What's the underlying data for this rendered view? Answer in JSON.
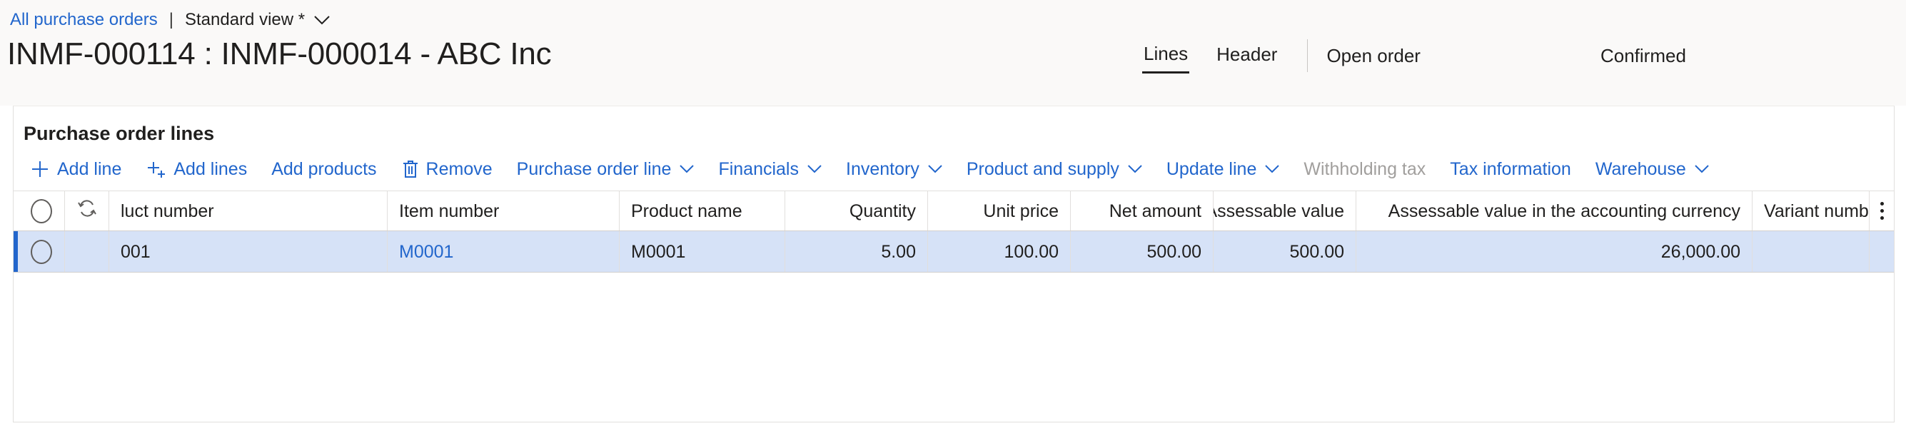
{
  "breadcrumb": {
    "back_link": "All purchase orders",
    "separator": "|",
    "view_name": "Standard view *",
    "chevron_icon": "chevron-down-icon"
  },
  "header": {
    "title": "INMF-000114 : INMF-000014 - ABC Inc",
    "tabs": [
      {
        "label": "Lines",
        "active": true
      },
      {
        "label": "Header",
        "active": false
      }
    ],
    "status": {
      "document_status": "Open order",
      "approval_status": "Confirmed"
    }
  },
  "section": {
    "title": "Purchase order lines"
  },
  "toolbar": {
    "items": [
      {
        "label": "Add line",
        "icon": "plus-icon",
        "has_caret": false,
        "disabled": false
      },
      {
        "label": "Add lines",
        "icon": "plus-lines-icon",
        "has_caret": false,
        "disabled": false
      },
      {
        "label": "Add products",
        "icon": "none",
        "has_caret": false,
        "disabled": false
      },
      {
        "label": "Remove",
        "icon": "trash-icon",
        "has_caret": false,
        "disabled": false
      },
      {
        "label": "Purchase order line",
        "icon": "none",
        "has_caret": true,
        "disabled": false
      },
      {
        "label": "Financials",
        "icon": "none",
        "has_caret": true,
        "disabled": false
      },
      {
        "label": "Inventory",
        "icon": "none",
        "has_caret": true,
        "disabled": false
      },
      {
        "label": "Product and supply",
        "icon": "none",
        "has_caret": true,
        "disabled": false
      },
      {
        "label": "Update line",
        "icon": "none",
        "has_caret": true,
        "disabled": false
      },
      {
        "label": "Withholding tax",
        "icon": "none",
        "has_caret": false,
        "disabled": true
      },
      {
        "label": "Tax information",
        "icon": "none",
        "has_caret": false,
        "disabled": false
      },
      {
        "label": "Warehouse",
        "icon": "none",
        "has_caret": true,
        "disabled": false
      }
    ]
  },
  "grid": {
    "select_all_icon": "radio-circle-icon",
    "system_column_icon": "refresh-sync-icon",
    "more_columns_icon": "kebab-menu-icon",
    "columns": [
      "luct number",
      "Item number",
      "Product name",
      "Quantity",
      "Unit price",
      "Net amount",
      "Assessable value",
      "Assessable value in the accounting currency",
      "Variant numbe"
    ],
    "rows": [
      {
        "selected": true,
        "row_selector_icon": "radio-circle-icon",
        "product_number": "001",
        "item_number": "M0001",
        "product_name": "M0001",
        "quantity": "5.00",
        "unit_price": "100.00",
        "net_amount": "500.00",
        "assessable_value": "500.00",
        "assessable_value_accounting_currency": "26,000.00",
        "variant_number": ""
      }
    ]
  },
  "colors": {
    "link": "#2266cc",
    "selected_row_bg": "#d6e2f7",
    "selection_bar": "#2266cc",
    "disabled_text": "#a19f9d",
    "page_header_bg": "#faf9f8"
  }
}
